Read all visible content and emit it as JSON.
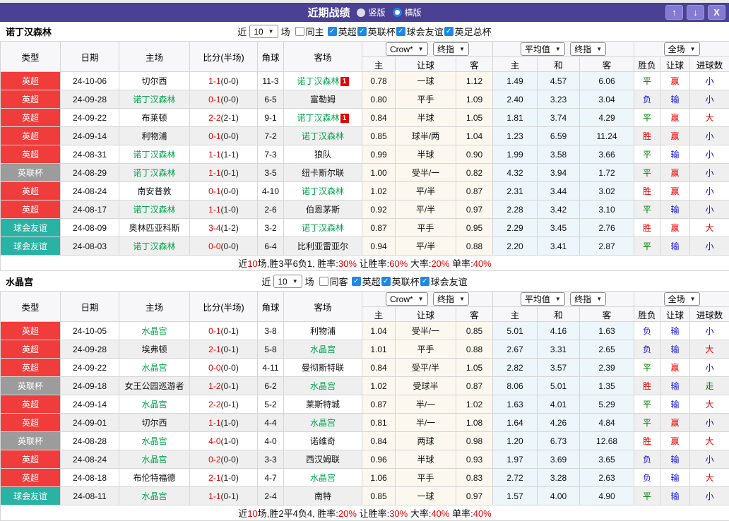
{
  "window": {
    "title": "近期战绩",
    "radios": [
      {
        "label": "竖版",
        "checked": false
      },
      {
        "label": "横版",
        "checked": true
      }
    ],
    "buttons": {
      "up": "↑",
      "down": "↓",
      "close": "X"
    }
  },
  "filter_labels": {
    "near": "近",
    "games": "场"
  },
  "columns": {
    "type": "类型",
    "date": "日期",
    "home": "主场",
    "score": "比分(半场)",
    "corner": "角球",
    "away": "客场",
    "handicap": [
      "主",
      "让球",
      "客"
    ],
    "euro": [
      "主",
      "和",
      "客"
    ],
    "result": [
      "胜负",
      "让球",
      "进球数"
    ],
    "selects": {
      "book": "Crow*",
      "final_a": "终指",
      "avg": "平均值",
      "final_b": "终指",
      "scope": "全场"
    }
  },
  "league_colors": {
    "英超": "#f13c3c",
    "英联杯": "#9c9c9c",
    "球会友谊": "#29b3a4"
  },
  "result_colors": {
    "胜": "#ea0000",
    "平": "#008000",
    "负": "#0f0fe0",
    "赢": "#ea0000",
    "输": "#0f0fe0",
    "大": "#ea0000",
    "小": "#0f0fe0",
    "走": "#008000"
  },
  "teams": [
    {
      "name": "诺丁汉森林",
      "filter": {
        "count": "10",
        "same_label": "同主",
        "same_checked": false,
        "leagues": [
          "英超",
          "英联杯",
          "球会友谊",
          "英足总杯"
        ]
      },
      "rows": [
        {
          "league": "英超",
          "date": "24-10-06",
          "home": "切尔西",
          "home_card": "",
          "score_ft": "1-1",
          "score_ht": "(0-0)",
          "corner": "11-3",
          "away": "诺丁汉森林",
          "away_card": "1",
          "h_home": "0.78",
          "h_line": "一球",
          "h_away": "1.12",
          "e_home": "1.49",
          "e_draw": "4.57",
          "e_away": "6.06",
          "r_win": "平",
          "r_handicap": "赢",
          "r_goal": "小"
        },
        {
          "league": "英超",
          "date": "24-09-28",
          "home": "诺丁汉森林",
          "home_card": "",
          "score_ft": "0-1",
          "score_ht": "(0-0)",
          "corner": "6-5",
          "away": "富勒姆",
          "away_card": "",
          "h_home": "0.80",
          "h_line": "平手",
          "h_away": "1.09",
          "e_home": "2.40",
          "e_draw": "3.23",
          "e_away": "3.04",
          "r_win": "负",
          "r_handicap": "输",
          "r_goal": "小"
        },
        {
          "league": "英超",
          "date": "24-09-22",
          "home": "布莱顿",
          "home_card": "",
          "score_ft": "2-2",
          "score_ht": "(2-1)",
          "corner": "9-1",
          "away": "诺丁汉森林",
          "away_card": "1",
          "h_home": "0.84",
          "h_line": "半球",
          "h_away": "1.05",
          "e_home": "1.81",
          "e_draw": "3.74",
          "e_away": "4.29",
          "r_win": "平",
          "r_handicap": "赢",
          "r_goal": "大"
        },
        {
          "league": "英超",
          "date": "24-09-14",
          "home": "利物浦",
          "home_card": "",
          "score_ft": "0-1",
          "score_ht": "(0-0)",
          "corner": "7-2",
          "away": "诺丁汉森林",
          "away_card": "",
          "h_home": "0.85",
          "h_line": "球半/两",
          "h_away": "1.04",
          "e_home": "1.23",
          "e_draw": "6.59",
          "e_away": "11.24",
          "r_win": "胜",
          "r_handicap": "赢",
          "r_goal": "小"
        },
        {
          "league": "英超",
          "date": "24-08-31",
          "home": "诺丁汉森林",
          "home_card": "",
          "score_ft": "1-1",
          "score_ht": "(1-1)",
          "corner": "7-3",
          "away": "狼队",
          "away_card": "",
          "h_home": "0.99",
          "h_line": "半球",
          "h_away": "0.90",
          "e_home": "1.99",
          "e_draw": "3.58",
          "e_away": "3.66",
          "r_win": "平",
          "r_handicap": "输",
          "r_goal": "小"
        },
        {
          "league": "英联杯",
          "date": "24-08-29",
          "home": "诺丁汉森林",
          "home_card": "",
          "score_ft": "1-1",
          "score_ht": "(0-1)",
          "corner": "3-5",
          "away": "纽卡斯尔联",
          "away_card": "",
          "h_home": "1.00",
          "h_line": "受半/一",
          "h_away": "0.82",
          "e_home": "4.32",
          "e_draw": "3.94",
          "e_away": "1.72",
          "r_win": "平",
          "r_handicap": "赢",
          "r_goal": "小"
        },
        {
          "league": "英超",
          "date": "24-08-24",
          "home": "南安普敦",
          "home_card": "",
          "score_ft": "0-1",
          "score_ht": "(0-0)",
          "corner": "4-10",
          "away": "诺丁汉森林",
          "away_card": "",
          "h_home": "1.02",
          "h_line": "平/半",
          "h_away": "0.87",
          "e_home": "2.31",
          "e_draw": "3.44",
          "e_away": "3.02",
          "r_win": "胜",
          "r_handicap": "赢",
          "r_goal": "小"
        },
        {
          "league": "英超",
          "date": "24-08-17",
          "home": "诺丁汉森林",
          "home_card": "",
          "score_ft": "1-1",
          "score_ht": "(1-0)",
          "corner": "2-6",
          "away": "伯恩茅斯",
          "away_card": "",
          "h_home": "0.92",
          "h_line": "平/半",
          "h_away": "0.97",
          "e_home": "2.28",
          "e_draw": "3.42",
          "e_away": "3.10",
          "r_win": "平",
          "r_handicap": "输",
          "r_goal": "小"
        },
        {
          "league": "球会友谊",
          "date": "24-08-09",
          "home": "奥林匹亚科斯",
          "home_card": "",
          "score_ft": "3-4",
          "score_ht": "(1-2)",
          "corner": "3-2",
          "away": "诺丁汉森林",
          "away_card": "",
          "h_home": "0.87",
          "h_line": "平手",
          "h_away": "0.95",
          "e_home": "2.29",
          "e_draw": "3.45",
          "e_away": "2.76",
          "r_win": "胜",
          "r_handicap": "赢",
          "r_goal": "大"
        },
        {
          "league": "球会友谊",
          "date": "24-08-03",
          "home": "诺丁汉森林",
          "home_card": "",
          "score_ft": "0-0",
          "score_ht": "(0-0)",
          "corner": "6-4",
          "away": "比利亚雷亚尔",
          "away_card": "",
          "h_home": "0.94",
          "h_line": "平/半",
          "h_away": "0.88",
          "e_home": "2.20",
          "e_draw": "3.41",
          "e_away": "2.87",
          "r_win": "平",
          "r_handicap": "输",
          "r_goal": "小"
        }
      ],
      "summary": [
        {
          "t": "近"
        },
        {
          "t": "10",
          "red": true
        },
        {
          "t": "场,胜3平6负1, 胜率:"
        },
        {
          "t": "30%",
          "red": true
        },
        {
          "t": " 让胜率:"
        },
        {
          "t": "60%",
          "red": true
        },
        {
          "t": " 大率:"
        },
        {
          "t": "20%",
          "red": true
        },
        {
          "t": " 单率:"
        },
        {
          "t": "40%",
          "red": true
        }
      ]
    },
    {
      "name": "水晶宫",
      "filter": {
        "count": "10",
        "same_label": "同客",
        "same_checked": false,
        "leagues": [
          "英超",
          "英联杯",
          "球会友谊"
        ]
      },
      "rows": [
        {
          "league": "英超",
          "date": "24-10-05",
          "home": "水晶宫",
          "home_card": "",
          "score_ft": "0-1",
          "score_ht": "(0-1)",
          "corner": "3-8",
          "away": "利物浦",
          "away_card": "",
          "h_home": "1.04",
          "h_line": "受半/一",
          "h_away": "0.85",
          "e_home": "5.01",
          "e_draw": "4.16",
          "e_away": "1.63",
          "r_win": "负",
          "r_handicap": "输",
          "r_goal": "小"
        },
        {
          "league": "英超",
          "date": "24-09-28",
          "home": "埃弗顿",
          "home_card": "",
          "score_ft": "2-1",
          "score_ht": "(0-1)",
          "corner": "5-8",
          "away": "水晶宫",
          "away_card": "",
          "h_home": "1.01",
          "h_line": "平手",
          "h_away": "0.88",
          "e_home": "2.67",
          "e_draw": "3.31",
          "e_away": "2.65",
          "r_win": "负",
          "r_handicap": "输",
          "r_goal": "大"
        },
        {
          "league": "英超",
          "date": "24-09-22",
          "home": "水晶宫",
          "home_card": "",
          "score_ft": "0-0",
          "score_ht": "(0-0)",
          "corner": "4-11",
          "away": "曼彻斯特联",
          "away_card": "",
          "h_home": "0.84",
          "h_line": "受平/半",
          "h_away": "1.05",
          "e_home": "2.82",
          "e_draw": "3.57",
          "e_away": "2.39",
          "r_win": "平",
          "r_handicap": "赢",
          "r_goal": "小"
        },
        {
          "league": "英联杯",
          "date": "24-09-18",
          "home": "女王公园巡游者",
          "home_card": "",
          "score_ft": "1-2",
          "score_ht": "(0-1)",
          "corner": "6-2",
          "away": "水晶宫",
          "away_card": "",
          "h_home": "1.02",
          "h_line": "受球半",
          "h_away": "0.87",
          "e_home": "8.06",
          "e_draw": "5.01",
          "e_away": "1.35",
          "r_win": "胜",
          "r_handicap": "输",
          "r_goal": "走"
        },
        {
          "league": "英超",
          "date": "24-09-14",
          "home": "水晶宫",
          "home_card": "",
          "score_ft": "2-2",
          "score_ht": "(0-1)",
          "corner": "5-2",
          "away": "莱斯特城",
          "away_card": "",
          "h_home": "0.87",
          "h_line": "半/一",
          "h_away": "1.02",
          "e_home": "1.63",
          "e_draw": "4.01",
          "e_away": "5.29",
          "r_win": "平",
          "r_handicap": "输",
          "r_goal": "大"
        },
        {
          "league": "英超",
          "date": "24-09-01",
          "home": "切尔西",
          "home_card": "",
          "score_ft": "1-1",
          "score_ht": "(1-0)",
          "corner": "4-4",
          "away": "水晶宫",
          "away_card": "",
          "h_home": "0.81",
          "h_line": "半/一",
          "h_away": "1.08",
          "e_home": "1.64",
          "e_draw": "4.26",
          "e_away": "4.84",
          "r_win": "平",
          "r_handicap": "赢",
          "r_goal": "小"
        },
        {
          "league": "英联杯",
          "date": "24-08-28",
          "home": "水晶宫",
          "home_card": "",
          "score_ft": "4-0",
          "score_ht": "(1-0)",
          "corner": "4-0",
          "away": "诺维奇",
          "away_card": "",
          "h_home": "0.84",
          "h_line": "两球",
          "h_away": "0.98",
          "e_home": "1.20",
          "e_draw": "6.73",
          "e_away": "12.68",
          "r_win": "胜",
          "r_handicap": "赢",
          "r_goal": "大"
        },
        {
          "league": "英超",
          "date": "24-08-24",
          "home": "水晶宫",
          "home_card": "",
          "score_ft": "0-2",
          "score_ht": "(0-0)",
          "corner": "3-3",
          "away": "西汉姆联",
          "away_card": "",
          "h_home": "0.96",
          "h_line": "半球",
          "h_away": "0.93",
          "e_home": "1.97",
          "e_draw": "3.69",
          "e_away": "3.65",
          "r_win": "负",
          "r_handicap": "输",
          "r_goal": "小"
        },
        {
          "league": "英超",
          "date": "24-08-18",
          "home": "布伦特福德",
          "home_card": "",
          "score_ft": "2-1",
          "score_ht": "(1-0)",
          "corner": "4-7",
          "away": "水晶宫",
          "away_card": "",
          "h_home": "1.06",
          "h_line": "平手",
          "h_away": "0.83",
          "e_home": "2.72",
          "e_draw": "3.28",
          "e_away": "2.63",
          "r_win": "负",
          "r_handicap": "输",
          "r_goal": "大"
        },
        {
          "league": "球会友谊",
          "date": "24-08-11",
          "home": "水晶宫",
          "home_card": "",
          "score_ft": "1-1",
          "score_ht": "(0-1)",
          "corner": "2-4",
          "away": "南特",
          "away_card": "",
          "h_home": "0.85",
          "h_line": "一球",
          "h_away": "0.97",
          "e_home": "1.57",
          "e_draw": "4.00",
          "e_away": "4.90",
          "r_win": "平",
          "r_handicap": "输",
          "r_goal": "小"
        }
      ],
      "summary": [
        {
          "t": "近"
        },
        {
          "t": "10",
          "red": true
        },
        {
          "t": "场,胜2平4负4, 胜率:"
        },
        {
          "t": "20%",
          "red": true
        },
        {
          "t": " 让胜率:"
        },
        {
          "t": "30%",
          "red": true
        },
        {
          "t": " 大率:"
        },
        {
          "t": "40%",
          "red": true
        },
        {
          "t": " 单率:"
        },
        {
          "t": "40%",
          "red": true
        }
      ]
    }
  ]
}
